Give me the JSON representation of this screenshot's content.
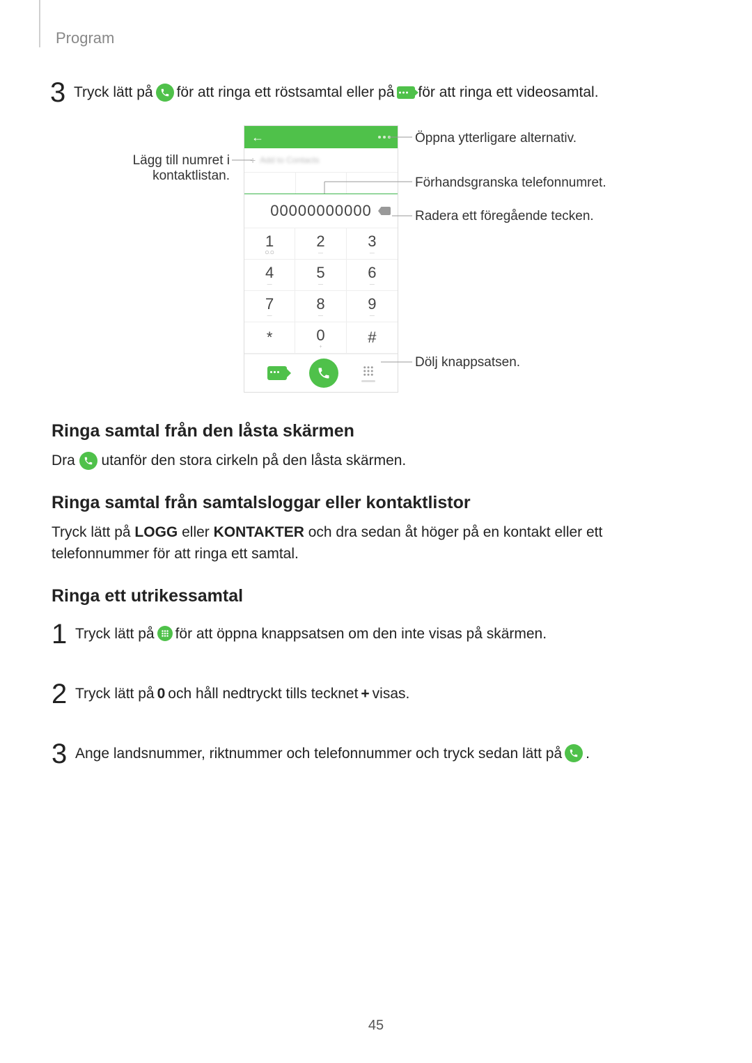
{
  "header": "Program",
  "page_number": "45",
  "step3": {
    "num": "3",
    "t1": "Tryck lätt på ",
    "t2": " för att ringa ett röstsamtal eller på ",
    "t3": " för att ringa ett videosamtal."
  },
  "phone": {
    "add_to_contacts": "Add to Contacts",
    "number": "00000000000",
    "keys": [
      "1",
      "2",
      "3",
      "4",
      "5",
      "6",
      "7",
      "8",
      "9",
      "*",
      "0",
      "#"
    ],
    "key_subs": [
      "O.O",
      "—",
      "—",
      "—",
      "—",
      "—",
      "—",
      "—",
      "—",
      "",
      "+",
      ""
    ]
  },
  "callouts": {
    "left_add": "Lägg till numret i kontaktlistan.",
    "right_more": "Öppna ytterligare alternativ.",
    "right_preview": "Förhandsgranska telefonnumret.",
    "right_delete": "Radera ett föregående tecken.",
    "right_hide": "Dölj knappsatsen."
  },
  "sec_lock_heading": "Ringa samtal från den låsta skärmen",
  "sec_lock": {
    "pre": "Dra ",
    "post": " utanför den stora cirkeln på den låsta skärmen."
  },
  "sec_logs_heading": "Ringa samtal från samtalsloggar eller kontaktlistor",
  "sec_logs": {
    "t1": "Tryck lätt på ",
    "b1": "LOGG",
    "t2": " eller ",
    "b2": "KONTAKTER",
    "t3": " och dra sedan åt höger på en kontakt eller ett telefonnummer för att ringa ett samtal."
  },
  "sec_intl_heading": "Ringa ett utrikessamtal",
  "intl_s1": {
    "num": "1",
    "pre": "Tryck lätt på ",
    "post": " för att öppna knappsatsen om den inte visas på skärmen."
  },
  "intl_s2": {
    "num": "2",
    "t1": "Tryck lätt på ",
    "b1": "0",
    "t2": " och håll nedtryckt tills tecknet ",
    "b2": "+",
    "t3": " visas."
  },
  "intl_s3": {
    "num": "3",
    "pre": "Ange landsnummer, riktnummer och telefonnummer och tryck sedan lätt på ",
    "post": "."
  }
}
